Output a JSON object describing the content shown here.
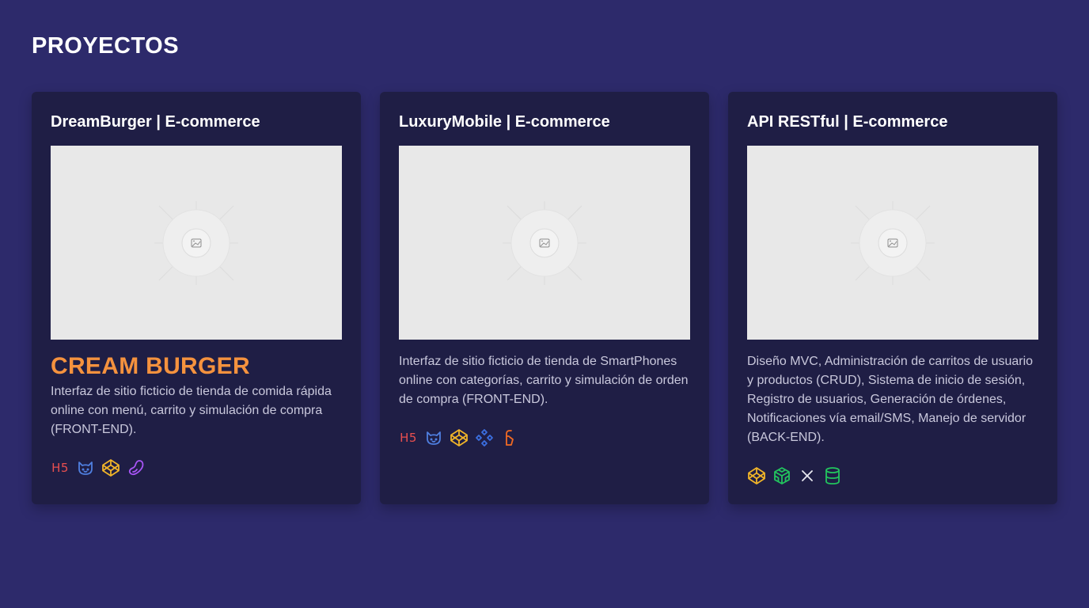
{
  "section": {
    "title": "PROYECTOS"
  },
  "projects": [
    {
      "title": "DreamBurger | E-commerce",
      "logo_text": "CREAM BURGER",
      "description": "Interfaz de sitio ficticio de tienda de comida rápida online con menú, carrito y simulación de compra (FRONT-END).",
      "tech_icons": [
        "html5-icon",
        "tailwind-cat-icon",
        "codepen-icon",
        "bean-icon"
      ]
    },
    {
      "title": "LuxuryMobile | E-commerce",
      "description": "Interfaz de sitio ficticio de tienda de SmartPhones online con categorías, carrito y simulación de orden de compra (FRONT-END).",
      "tech_icons": [
        "html5-icon",
        "tailwind-cat-icon",
        "codepen-icon",
        "diamonds-icon",
        "firebase-icon"
      ]
    },
    {
      "title": "API RESTful | E-commerce",
      "description": "Diseño MVC, Administración de carritos de usuario y productos (CRUD), Sistema de inicio de sesión, Registro de usuarios, Generación de órdenes, Notificaciones vía email/SMS, Manejo de servidor (BACK-END).",
      "tech_icons": [
        "codepen-icon",
        "codesandbox-icon",
        "express-x-icon",
        "database-icon"
      ]
    }
  ],
  "icon_text": {
    "html5": "H5"
  },
  "colors": {
    "background": "#2d2a6b",
    "card": "#1f1e45",
    "accent_orange": "#f5923e",
    "html5_red": "#e94f4f",
    "blue": "#4f7fe0",
    "yellow": "#f0b429",
    "purple": "#a855f7",
    "green": "#22c55e",
    "firebase_orange": "#f06a23"
  }
}
